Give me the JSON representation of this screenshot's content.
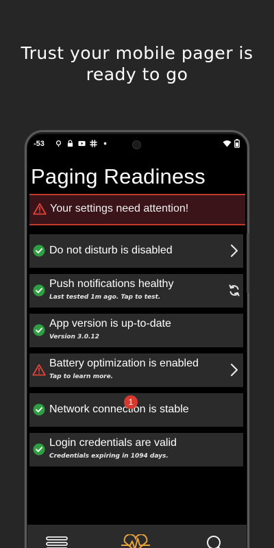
{
  "headline": "Trust your mobile pager is ready to go",
  "status_bar": {
    "time": "-53",
    "icons": [
      "map-pin-icon",
      "lock-icon",
      "video-icon",
      "slack-icon",
      "dot-icon"
    ],
    "right_icons": [
      "wifi-icon",
      "battery-icon"
    ]
  },
  "screen": {
    "title": "Paging Readiness",
    "alert": {
      "text": "Your settings need attention!",
      "icon": "warning-icon"
    },
    "checks": [
      {
        "title": "Do not disturb is disabled",
        "subtitle": "",
        "status": "ok",
        "action": "chevron-right-icon"
      },
      {
        "title": "Push notifications healthy",
        "subtitle": "Last tested 1m ago. Tap to test.",
        "status": "ok",
        "action": "refresh-icon"
      },
      {
        "title": "App version is up-to-date",
        "subtitle": "Version 3.0.12",
        "status": "ok",
        "action": ""
      },
      {
        "title": "Battery optimization is enabled",
        "subtitle": "Tap to learn more.",
        "status": "warning",
        "action": "chevron-right-icon"
      },
      {
        "title": "Network connection is stable",
        "subtitle": "",
        "status": "ok",
        "action": ""
      },
      {
        "title": "Login credentials are valid",
        "subtitle": "Credentials expiring in 1094 days.",
        "status": "ok",
        "action": ""
      }
    ]
  },
  "nav": {
    "items": [
      "menu-icon",
      "heart-pulse-icon",
      "search-icon"
    ],
    "badge": "1"
  },
  "colors": {
    "background": "#262626",
    "card": "#2b2b2b",
    "ok_green": "#2ea043",
    "warning_red": "#c0392b",
    "alert_background": "#3a1418"
  }
}
